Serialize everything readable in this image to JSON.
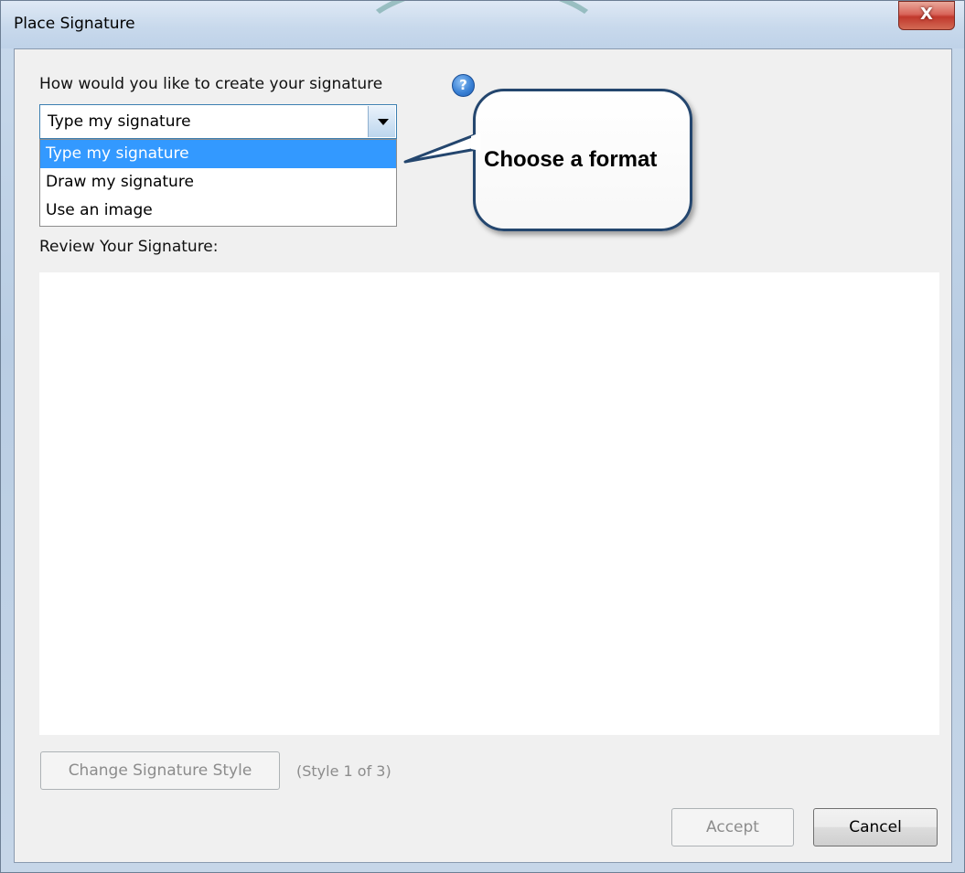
{
  "window": {
    "title": "Place Signature",
    "close_glyph": "X"
  },
  "form": {
    "prompt": "How would you like to create your signature",
    "help_glyph": "?",
    "select": {
      "value": "Type my signature",
      "options": [
        "Type my signature",
        "Draw my signature",
        "Use an image"
      ],
      "selected_index": 0
    },
    "review_label": "Review Your Signature:"
  },
  "style_controls": {
    "change_style_label": "Change Signature Style",
    "style_count": "(Style 1 of 3)"
  },
  "footer": {
    "accept_label": "Accept",
    "cancel_label": "Cancel"
  },
  "callout": {
    "text": "Choose a format"
  },
  "colors": {
    "selection": "#3399ff",
    "callout_border": "#24466e",
    "close_button": "#c1382c"
  },
  "icons": {
    "help": "help-icon",
    "close": "close-icon",
    "dropdown": "chevron-down-icon"
  }
}
